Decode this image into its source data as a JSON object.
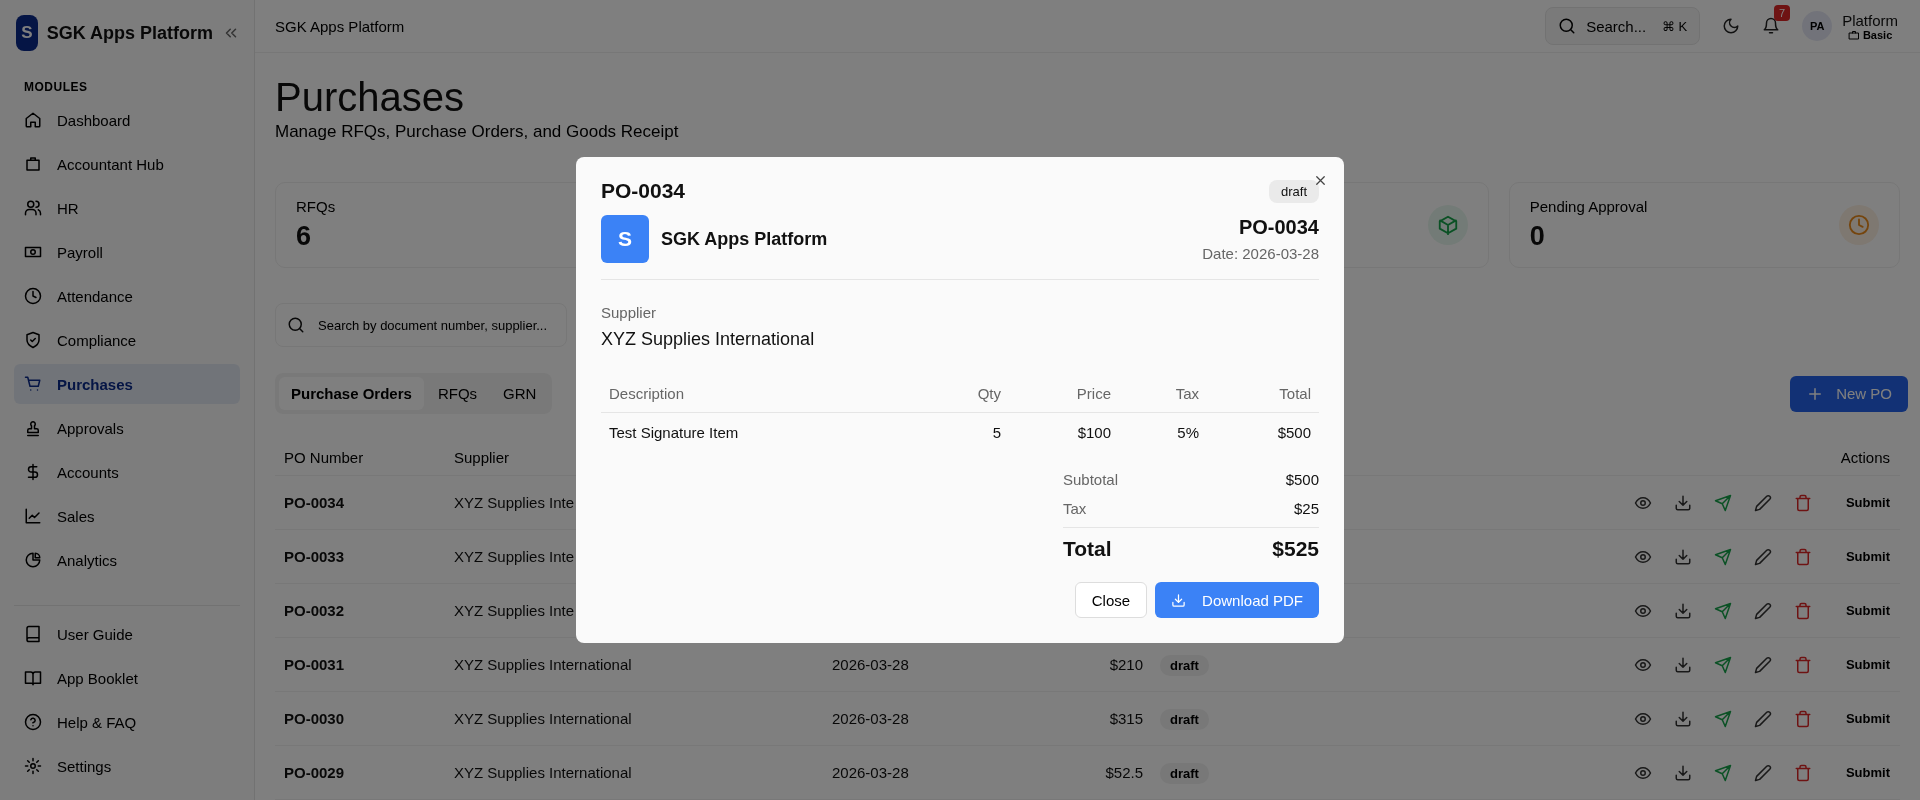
{
  "sidebar": {
    "logo": "S",
    "title": "SGK Apps Platform",
    "section": "MODULES",
    "items": [
      {
        "label": "Dashboard",
        "selected": false
      },
      {
        "label": "Accountant Hub",
        "selected": false
      },
      {
        "label": "HR",
        "selected": false
      },
      {
        "label": "Payroll",
        "selected": false
      },
      {
        "label": "Attendance",
        "selected": false
      },
      {
        "label": "Compliance",
        "selected": false
      },
      {
        "label": "Purchases",
        "selected": true
      },
      {
        "label": "Approvals",
        "selected": false
      },
      {
        "label": "Accounts",
        "selected": false
      },
      {
        "label": "Sales",
        "selected": false
      },
      {
        "label": "Analytics",
        "selected": false
      }
    ],
    "footer_items": [
      {
        "label": "User Guide"
      },
      {
        "label": "App Booklet"
      },
      {
        "label": "Help & FAQ"
      },
      {
        "label": "Settings"
      }
    ]
  },
  "header": {
    "breadcrumb": "SGK Apps Platform",
    "search": {
      "placeholder": "Search...",
      "shortcut": "⌘ K"
    },
    "notifications": "7",
    "user": {
      "initials": "PA",
      "name": "Platform",
      "plan": "Basic"
    }
  },
  "page": {
    "title": "Purchases",
    "subtitle": "Manage RFQs, Purchase Orders, and Goods Receipt"
  },
  "stats": [
    {
      "label": "RFQs",
      "value": "6"
    },
    {
      "label": "Pending Approval",
      "value": "0"
    }
  ],
  "search": {
    "placeholder": "Search by document number, supplier..."
  },
  "tabs": [
    {
      "label": "Purchase Orders",
      "selected": true
    },
    {
      "label": "RFQs",
      "selected": false
    },
    {
      "label": "GRN",
      "selected": false
    }
  ],
  "new_button": "New PO",
  "table": {
    "columns": {
      "po_number": "PO Number",
      "supplier": "Supplier",
      "actions": "Actions"
    },
    "rows": [
      {
        "po": "PO-0034",
        "supplier": "XYZ Supplies Inte",
        "action": "Submit"
      },
      {
        "po": "PO-0033",
        "supplier": "XYZ Supplies Inte",
        "action": "Submit"
      },
      {
        "po": "PO-0032",
        "supplier": "XYZ Supplies Inte",
        "action": "Submit"
      },
      {
        "po": "PO-0031",
        "supplier": "XYZ Supplies International",
        "date": "2026-03-28",
        "amount": "$210",
        "status": "draft",
        "action": "Submit"
      },
      {
        "po": "PO-0030",
        "supplier": "XYZ Supplies International",
        "date": "2026-03-28",
        "amount": "$315",
        "status": "draft",
        "action": "Submit"
      },
      {
        "po": "PO-0029",
        "supplier": "XYZ Supplies International",
        "date": "2026-03-28",
        "amount": "$52.5",
        "status": "draft",
        "action": "Submit"
      }
    ]
  },
  "modal": {
    "title": "PO-0034",
    "status": "draft",
    "logo": "S",
    "company": "SGK Apps Platform",
    "number": "PO-0034",
    "date": "Date: 2026-03-28",
    "supplier_label": "Supplier",
    "supplier": "XYZ Supplies International",
    "columns": [
      "Description",
      "Qty",
      "Price",
      "Tax",
      "Total"
    ],
    "items": [
      {
        "description": "Test Signature Item",
        "qty": "5",
        "price": "$100",
        "tax": "5%",
        "total": "$500"
      }
    ],
    "totals": [
      {
        "label": "Subtotal",
        "value": "$500"
      },
      {
        "label": "Tax",
        "value": "$25"
      }
    ],
    "grand_total": {
      "label": "Total",
      "value": "$525"
    },
    "buttons": {
      "close": "Close",
      "download": "Download PDF"
    }
  }
}
